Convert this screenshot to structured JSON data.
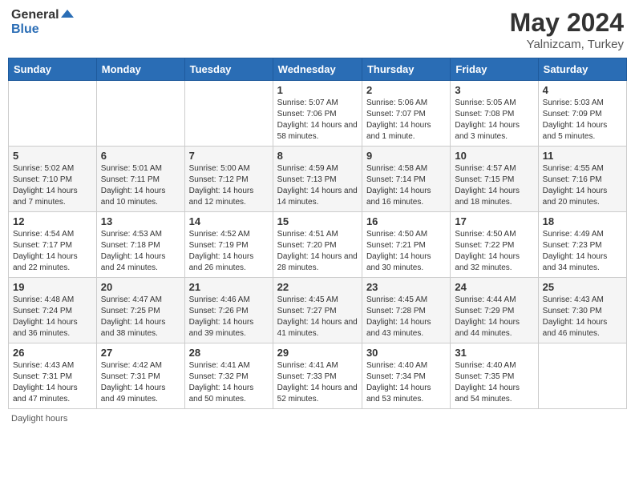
{
  "header": {
    "logo_line1": "General",
    "logo_line2": "Blue",
    "main_title": "May 2024",
    "subtitle": "Yalnizcam, Turkey"
  },
  "days_of_week": [
    "Sunday",
    "Monday",
    "Tuesday",
    "Wednesday",
    "Thursday",
    "Friday",
    "Saturday"
  ],
  "weeks": [
    [
      {
        "num": "",
        "text": ""
      },
      {
        "num": "",
        "text": ""
      },
      {
        "num": "",
        "text": ""
      },
      {
        "num": "1",
        "text": "Sunrise: 5:07 AM\nSunset: 7:06 PM\nDaylight: 14 hours and 58 minutes."
      },
      {
        "num": "2",
        "text": "Sunrise: 5:06 AM\nSunset: 7:07 PM\nDaylight: 14 hours and 1 minute."
      },
      {
        "num": "3",
        "text": "Sunrise: 5:05 AM\nSunset: 7:08 PM\nDaylight: 14 hours and 3 minutes."
      },
      {
        "num": "4",
        "text": "Sunrise: 5:03 AM\nSunset: 7:09 PM\nDaylight: 14 hours and 5 minutes."
      }
    ],
    [
      {
        "num": "5",
        "text": "Sunrise: 5:02 AM\nSunset: 7:10 PM\nDaylight: 14 hours and 7 minutes."
      },
      {
        "num": "6",
        "text": "Sunrise: 5:01 AM\nSunset: 7:11 PM\nDaylight: 14 hours and 10 minutes."
      },
      {
        "num": "7",
        "text": "Sunrise: 5:00 AM\nSunset: 7:12 PM\nDaylight: 14 hours and 12 minutes."
      },
      {
        "num": "8",
        "text": "Sunrise: 4:59 AM\nSunset: 7:13 PM\nDaylight: 14 hours and 14 minutes."
      },
      {
        "num": "9",
        "text": "Sunrise: 4:58 AM\nSunset: 7:14 PM\nDaylight: 14 hours and 16 minutes."
      },
      {
        "num": "10",
        "text": "Sunrise: 4:57 AM\nSunset: 7:15 PM\nDaylight: 14 hours and 18 minutes."
      },
      {
        "num": "11",
        "text": "Sunrise: 4:55 AM\nSunset: 7:16 PM\nDaylight: 14 hours and 20 minutes."
      }
    ],
    [
      {
        "num": "12",
        "text": "Sunrise: 4:54 AM\nSunset: 7:17 PM\nDaylight: 14 hours and 22 minutes."
      },
      {
        "num": "13",
        "text": "Sunrise: 4:53 AM\nSunset: 7:18 PM\nDaylight: 14 hours and 24 minutes."
      },
      {
        "num": "14",
        "text": "Sunrise: 4:52 AM\nSunset: 7:19 PM\nDaylight: 14 hours and 26 minutes."
      },
      {
        "num": "15",
        "text": "Sunrise: 4:51 AM\nSunset: 7:20 PM\nDaylight: 14 hours and 28 minutes."
      },
      {
        "num": "16",
        "text": "Sunrise: 4:50 AM\nSunset: 7:21 PM\nDaylight: 14 hours and 30 minutes."
      },
      {
        "num": "17",
        "text": "Sunrise: 4:50 AM\nSunset: 7:22 PM\nDaylight: 14 hours and 32 minutes."
      },
      {
        "num": "18",
        "text": "Sunrise: 4:49 AM\nSunset: 7:23 PM\nDaylight: 14 hours and 34 minutes."
      }
    ],
    [
      {
        "num": "19",
        "text": "Sunrise: 4:48 AM\nSunset: 7:24 PM\nDaylight: 14 hours and 36 minutes."
      },
      {
        "num": "20",
        "text": "Sunrise: 4:47 AM\nSunset: 7:25 PM\nDaylight: 14 hours and 38 minutes."
      },
      {
        "num": "21",
        "text": "Sunrise: 4:46 AM\nSunset: 7:26 PM\nDaylight: 14 hours and 39 minutes."
      },
      {
        "num": "22",
        "text": "Sunrise: 4:45 AM\nSunset: 7:27 PM\nDaylight: 14 hours and 41 minutes."
      },
      {
        "num": "23",
        "text": "Sunrise: 4:45 AM\nSunset: 7:28 PM\nDaylight: 14 hours and 43 minutes."
      },
      {
        "num": "24",
        "text": "Sunrise: 4:44 AM\nSunset: 7:29 PM\nDaylight: 14 hours and 44 minutes."
      },
      {
        "num": "25",
        "text": "Sunrise: 4:43 AM\nSunset: 7:30 PM\nDaylight: 14 hours and 46 minutes."
      }
    ],
    [
      {
        "num": "26",
        "text": "Sunrise: 4:43 AM\nSunset: 7:31 PM\nDaylight: 14 hours and 47 minutes."
      },
      {
        "num": "27",
        "text": "Sunrise: 4:42 AM\nSunset: 7:31 PM\nDaylight: 14 hours and 49 minutes."
      },
      {
        "num": "28",
        "text": "Sunrise: 4:41 AM\nSunset: 7:32 PM\nDaylight: 14 hours and 50 minutes."
      },
      {
        "num": "29",
        "text": "Sunrise: 4:41 AM\nSunset: 7:33 PM\nDaylight: 14 hours and 52 minutes."
      },
      {
        "num": "30",
        "text": "Sunrise: 4:40 AM\nSunset: 7:34 PM\nDaylight: 14 hours and 53 minutes."
      },
      {
        "num": "31",
        "text": "Sunrise: 4:40 AM\nSunset: 7:35 PM\nDaylight: 14 hours and 54 minutes."
      },
      {
        "num": "",
        "text": ""
      }
    ]
  ],
  "footer": "Daylight hours"
}
